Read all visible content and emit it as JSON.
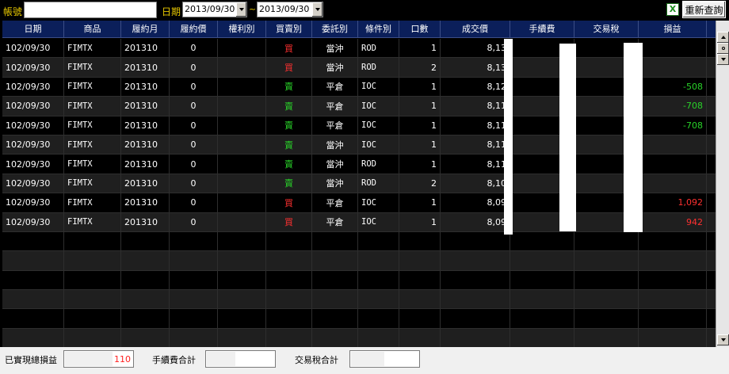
{
  "toolbar": {
    "account_label": "帳號",
    "account_value": "",
    "date_label": "日期",
    "date_from": "2013/09/30",
    "date_sep": "~",
    "date_to": "2013/09/30",
    "excel_icon_glyph": "X",
    "requery_label": "重新查詢"
  },
  "table": {
    "columns": [
      "日期",
      "商品",
      "履約月",
      "履約價",
      "權利別",
      "買賣別",
      "委託別",
      "條件別",
      "口數",
      "成交價",
      "手續費",
      "交易稅",
      "損益"
    ],
    "rows": [
      {
        "date": "102/09/30",
        "product": "FIMTX",
        "month": "201310",
        "strike": "0",
        "right": "",
        "side": "買",
        "order": "當沖",
        "cond": "ROD",
        "qty": "1",
        "price": "8,13",
        "fee": "",
        "tax": "",
        "pnl": ""
      },
      {
        "date": "102/09/30",
        "product": "FIMTX",
        "month": "201310",
        "strike": "0",
        "right": "",
        "side": "買",
        "order": "當沖",
        "cond": "ROD",
        "qty": "2",
        "price": "8,13",
        "fee": "",
        "tax": "",
        "pnl": ""
      },
      {
        "date": "102/09/30",
        "product": "FIMTX",
        "month": "201310",
        "strike": "0",
        "right": "",
        "side": "賣",
        "order": "平倉",
        "cond": "IOC",
        "qty": "1",
        "price": "8,12",
        "fee": "",
        "tax": "",
        "pnl": "-508"
      },
      {
        "date": "102/09/30",
        "product": "FIMTX",
        "month": "201310",
        "strike": "0",
        "right": "",
        "side": "賣",
        "order": "平倉",
        "cond": "IOC",
        "qty": "1",
        "price": "8,11",
        "fee": "",
        "tax": "",
        "pnl": "-708"
      },
      {
        "date": "102/09/30",
        "product": "FIMTX",
        "month": "201310",
        "strike": "0",
        "right": "",
        "side": "賣",
        "order": "平倉",
        "cond": "IOC",
        "qty": "1",
        "price": "8,11",
        "fee": "",
        "tax": "",
        "pnl": "-708"
      },
      {
        "date": "102/09/30",
        "product": "FIMTX",
        "month": "201310",
        "strike": "0",
        "right": "",
        "side": "賣",
        "order": "當沖",
        "cond": "IOC",
        "qty": "1",
        "price": "8,11",
        "fee": "",
        "tax": "",
        "pnl": ""
      },
      {
        "date": "102/09/30",
        "product": "FIMTX",
        "month": "201310",
        "strike": "0",
        "right": "",
        "side": "賣",
        "order": "當沖",
        "cond": "ROD",
        "qty": "1",
        "price": "8,11",
        "fee": "",
        "tax": "",
        "pnl": ""
      },
      {
        "date": "102/09/30",
        "product": "FIMTX",
        "month": "201310",
        "strike": "0",
        "right": "",
        "side": "賣",
        "order": "當沖",
        "cond": "ROD",
        "qty": "2",
        "price": "8,10",
        "fee": "",
        "tax": "",
        "pnl": ""
      },
      {
        "date": "102/09/30",
        "product": "FIMTX",
        "month": "201310",
        "strike": "0",
        "right": "",
        "side": "買",
        "order": "平倉",
        "cond": "IOC",
        "qty": "1",
        "price": "8,09",
        "fee": "",
        "tax": "",
        "pnl": "1,092"
      },
      {
        "date": "102/09/30",
        "product": "FIMTX",
        "month": "201310",
        "strike": "0",
        "right": "",
        "side": "買",
        "order": "平倉",
        "cond": "IOC",
        "qty": "1",
        "price": "8,09",
        "fee": "",
        "tax": "",
        "pnl": "942"
      }
    ],
    "empty_rows": 6
  },
  "footer": {
    "realized_label": "已實現總損益",
    "realized_value": "110",
    "fee_total_label": "手續費合計",
    "fee_total_value": "",
    "tax_total_label": "交易稅合計",
    "tax_total_value": ""
  },
  "colors": {
    "buy": "#ff3030",
    "sell": "#29d229",
    "loss": "#29d229",
    "gain": "#ff3030",
    "header_bg": "#0b1f5a",
    "label_yellow": "#e8c800"
  },
  "icons": {
    "excel_export": "excel-icon",
    "dropdown": "chevron-down-icon",
    "scroll_up": "arrow-up-icon",
    "scroll_down": "arrow-down-icon"
  }
}
